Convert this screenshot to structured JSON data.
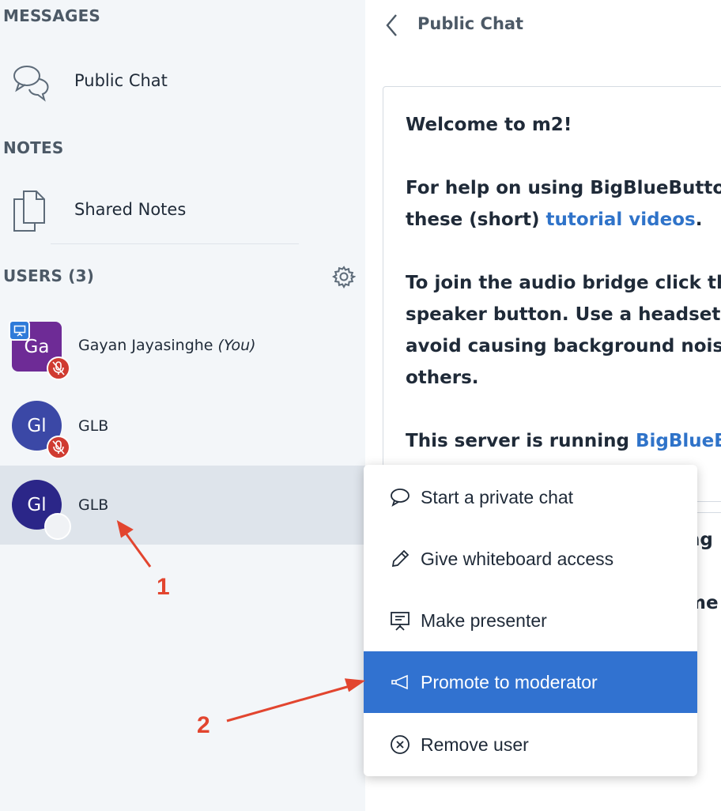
{
  "sidebar": {
    "messages_title": "MESSAGES",
    "public_chat_label": "Public Chat",
    "notes_title": "NOTES",
    "shared_notes_label": "Shared Notes",
    "users_title": "USERS (3)",
    "users": [
      {
        "initials": "Ga",
        "name": "Gayan Jayasinghe",
        "suffix": "(You)",
        "avatar_color": "#6e2b96",
        "muted": true,
        "presenter": true
      },
      {
        "initials": "Gl",
        "name": "GLB",
        "avatar_color": "#3b48a6",
        "muted": true
      },
      {
        "initials": "Gl",
        "name": "GLB",
        "avatar_color": "#2b2688",
        "muted": false,
        "selected": true
      }
    ]
  },
  "chat": {
    "header_title": "Public Chat",
    "welcome_prefix": "Welcome to ",
    "welcome_name": "m2",
    "welcome_suffix": "!",
    "help_line1": "For help on using BigBlueButton s",
    "help_line2_prefix": "these (short) ",
    "help_link": "tutorial videos",
    "help_line2_suffix": ".",
    "audio_line1": "To join the audio bridge click the",
    "audio_line2": "speaker button. Use a headset to",
    "audio_line3": "avoid causing background noise f",
    "audio_line4": "others.",
    "server_prefix": "This server is running ",
    "server_link": "BigBlueButt",
    "partial_1": "ng",
    "partial_2": "me"
  },
  "context_menu": {
    "items": [
      {
        "label": "Start a private chat",
        "icon": "chat-bubble-icon"
      },
      {
        "label": "Give whiteboard access",
        "icon": "pencil-icon"
      },
      {
        "label": "Make presenter",
        "icon": "presentation-icon"
      },
      {
        "label": "Promote to moderator",
        "icon": "megaphone-icon",
        "highlighted": true
      },
      {
        "label": "Remove user",
        "icon": "remove-circle-icon"
      }
    ]
  },
  "annotations": {
    "label_1": "1",
    "label_2": "2",
    "color": "#e2452f"
  },
  "colors": {
    "accent": "#3172d0",
    "link": "#2f73c9",
    "muted_badge": "#d03b31",
    "presenter_badge": "#2f7bd9"
  }
}
